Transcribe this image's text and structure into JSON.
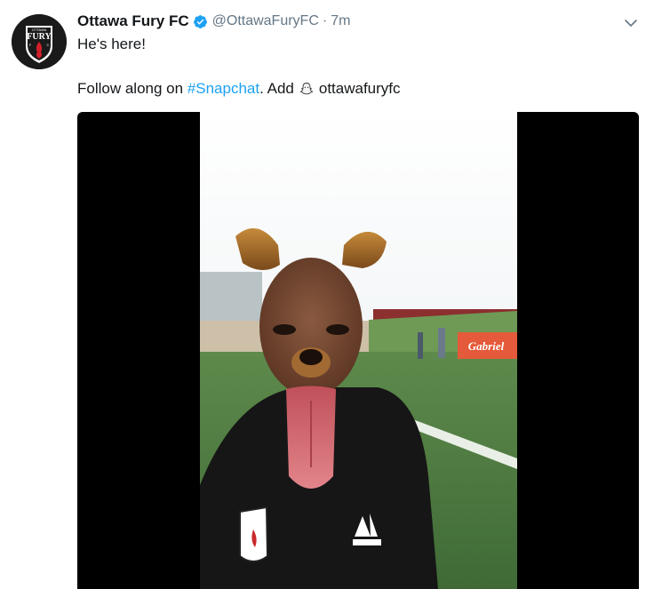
{
  "tweet": {
    "author_name": "Ottawa Fury FC",
    "handle": "@OttawaFuryFC",
    "separator": "·",
    "time": "7m",
    "line1": "He's here!",
    "line2_prefix": "Follow along on ",
    "hashtag": "#Snapchat",
    "line2_mid": ". Add",
    "snap_user": "ottawafuryfc"
  },
  "avatar": {
    "badge_top": "OTTAWA",
    "badge_word": "FURY",
    "badge_left": "F",
    "badge_right": "C"
  },
  "media": {
    "sign_text": "Gabriel"
  },
  "icons": {
    "verified": "verified-badge-icon",
    "caret": "chevron-down-icon",
    "ghost": "snapchat-ghost-icon"
  },
  "colors": {
    "link": "#1da1f2",
    "secondary_text": "#657786",
    "primary_text": "#14171a"
  }
}
